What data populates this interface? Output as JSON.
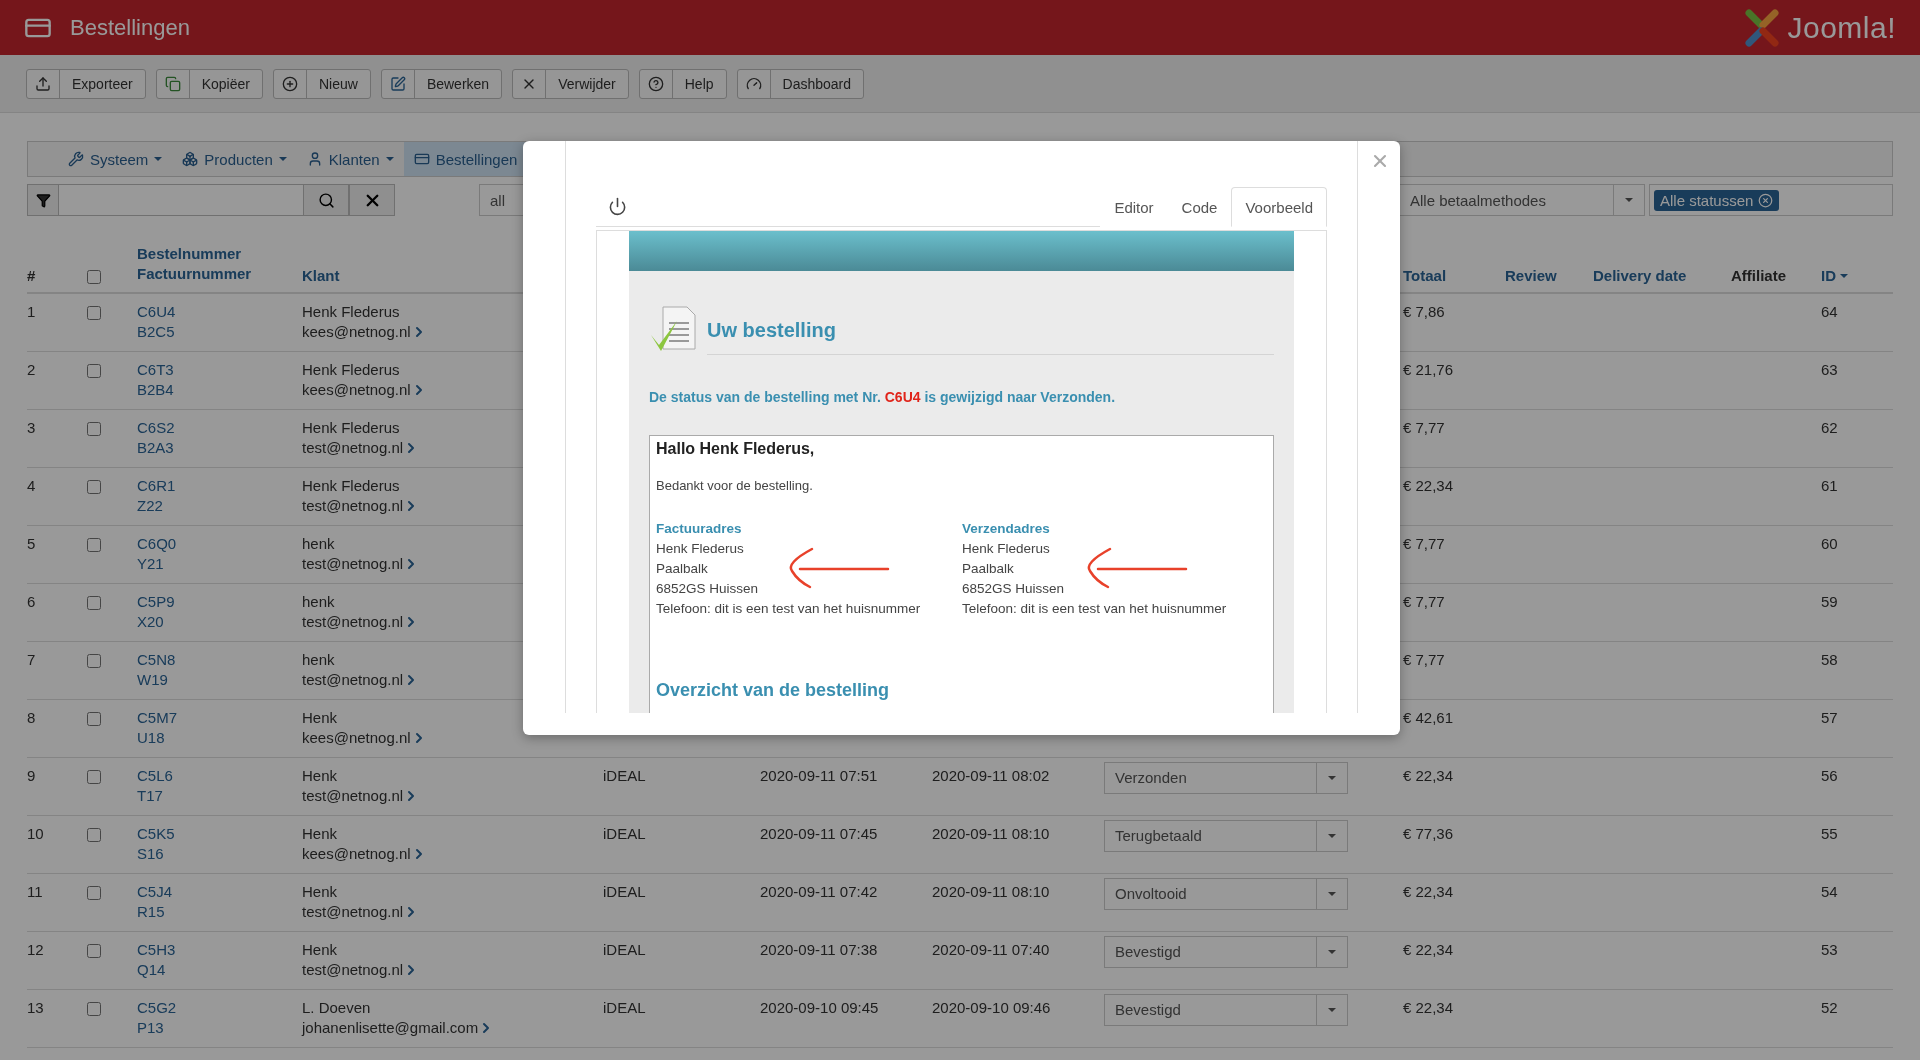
{
  "header": {
    "title": "Bestellingen",
    "logo_text": "Joomla!"
  },
  "toolbar": [
    {
      "kind": "export",
      "label": "Exporteer"
    },
    {
      "kind": "copy",
      "label": "Kopiëer"
    },
    {
      "kind": "new",
      "label": "Nieuw"
    },
    {
      "kind": "edit",
      "label": "Bewerken"
    },
    {
      "kind": "delete",
      "label": "Verwijder"
    },
    {
      "kind": "help",
      "label": "Help"
    },
    {
      "kind": "dashboard",
      "label": "Dashboard"
    }
  ],
  "submenu": [
    {
      "kind": "system",
      "label": "Systeem",
      "selected": false
    },
    {
      "kind": "products",
      "label": "Producten",
      "selected": false
    },
    {
      "kind": "customers",
      "label": "Klanten",
      "selected": false
    },
    {
      "kind": "orders",
      "label": "Bestellingen",
      "selected": true
    }
  ],
  "filters": {
    "date_select": "all",
    "payment_select": "Alle betaalmethodes",
    "status_tag": "Alle statussen"
  },
  "table": {
    "select_all_checked": false,
    "columns": {
      "number": "#",
      "order_number": "Bestelnummer",
      "invoice_number": "Factuurnummer",
      "customer": "Klant",
      "total": "Totaal",
      "review": "Review",
      "delivery_date": "Delivery date",
      "affiliate": "Affiliate",
      "id": "ID"
    },
    "rows": [
      {
        "n": "1",
        "checked": false,
        "order": "C6U4",
        "invoice": "B2C5",
        "name": "Henk Flederus",
        "email": "kees@netnog.nl",
        "total": "€ 7,86",
        "id": "64"
      },
      {
        "n": "2",
        "checked": false,
        "order": "C6T3",
        "invoice": "B2B4",
        "name": "Henk Flederus",
        "email": "kees@netnog.nl",
        "total": "€ 21,76",
        "id": "63"
      },
      {
        "n": "3",
        "checked": false,
        "order": "C6S2",
        "invoice": "B2A3",
        "name": "Henk Flederus",
        "email": "test@netnog.nl",
        "total": "€ 7,77",
        "id": "62"
      },
      {
        "n": "4",
        "checked": false,
        "order": "C6R1",
        "invoice": "Z22",
        "name": "Henk Flederus",
        "email": "test@netnog.nl",
        "total": "€ 22,34",
        "id": "61"
      },
      {
        "n": "5",
        "checked": false,
        "order": "C6Q0",
        "invoice": "Y21",
        "name": "henk",
        "email": "test@netnog.nl",
        "total": "€ 7,77",
        "id": "60"
      },
      {
        "n": "6",
        "checked": false,
        "order": "C5P9",
        "invoice": "X20",
        "name": "henk",
        "email": "test@netnog.nl",
        "total": "€ 7,77",
        "id": "59"
      },
      {
        "n": "7",
        "checked": false,
        "order": "C5N8",
        "invoice": "W19",
        "name": "henk",
        "email": "test@netnog.nl",
        "total": "€ 7,77",
        "id": "58"
      },
      {
        "n": "8",
        "checked": false,
        "order": "C5M7",
        "invoice": "U18",
        "name": "Henk",
        "email": "kees@netnog.nl",
        "total": "€ 42,61",
        "id": "57"
      },
      {
        "n": "9",
        "checked": false,
        "order": "C5L6",
        "invoice": "T17",
        "name": "Henk",
        "email": "test@netnog.nl",
        "payment": "iDEAL",
        "created": "2020-09-11 07:51",
        "modified": "2020-09-11 08:02",
        "status": "Verzonden",
        "total": "€ 22,34",
        "id": "56"
      },
      {
        "n": "10",
        "checked": false,
        "order": "C5K5",
        "invoice": "S16",
        "name": "Henk",
        "email": "kees@netnog.nl",
        "payment": "iDEAL",
        "created": "2020-09-11 07:45",
        "modified": "2020-09-11 08:10",
        "status": "Terugbetaald",
        "total": "€ 77,36",
        "id": "55"
      },
      {
        "n": "11",
        "checked": false,
        "order": "C5J4",
        "invoice": "R15",
        "name": "Henk",
        "email": "test@netnog.nl",
        "payment": "iDEAL",
        "created": "2020-09-11 07:42",
        "modified": "2020-09-11 08:10",
        "status": "Onvoltooid",
        "total": "€ 22,34",
        "id": "54"
      },
      {
        "n": "12",
        "checked": false,
        "order": "C5H3",
        "invoice": "Q14",
        "name": "Henk",
        "email": "test@netnog.nl",
        "payment": "iDEAL",
        "created": "2020-09-11 07:38",
        "modified": "2020-09-11 07:40",
        "status": "Bevestigd",
        "total": "€ 22,34",
        "id": "53"
      },
      {
        "n": "13",
        "checked": false,
        "order": "C5G2",
        "invoice": "P13",
        "name": "L. Doeven",
        "email": "johanenlisette@gmail.com",
        "payment": "iDEAL",
        "created": "2020-09-10 09:45",
        "modified": "2020-09-10 09:46",
        "status": "Bevestigd",
        "total": "€ 22,34",
        "id": "52"
      }
    ]
  },
  "modal": {
    "tabs": [
      {
        "label": "Editor",
        "selected": false
      },
      {
        "label": "Code",
        "selected": false
      },
      {
        "label": "Voorbeeld",
        "selected": true
      }
    ],
    "email": {
      "title": "Uw bestelling",
      "status_message": {
        "before": "De status van de bestelling met Nr.",
        "order_number": "C6U4",
        "after": "is gewijzigd naar Verzonden."
      },
      "greeting": "Hallo Henk Flederus,",
      "thanks": "Bedankt voor de bestelling.",
      "addresses": [
        {
          "heading": "Factuuradres",
          "lines": [
            "Henk Flederus",
            "Paalbalk",
            "6852GS Huissen",
            "Telefoon: dit is een test van het huisnummer"
          ]
        },
        {
          "heading": "Verzendadres",
          "lines": [
            "Henk Flederus",
            "Paalbalk",
            "6852GS Huissen",
            "Telefoon: dit is een test van het huisnummer"
          ]
        }
      ],
      "overview_heading": "Overzicht van de bestelling"
    }
  }
}
